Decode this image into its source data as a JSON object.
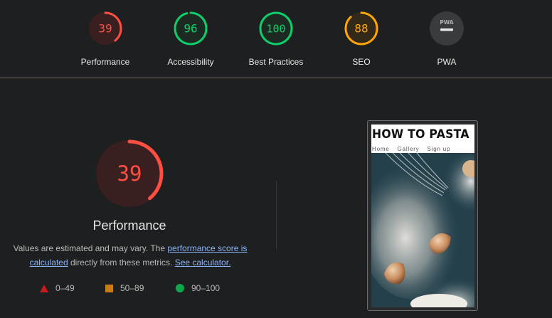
{
  "top_gauges": [
    {
      "name": "performance",
      "score": "39",
      "label": "Performance",
      "status": "fail",
      "fraction": 0.39
    },
    {
      "name": "accessibility",
      "score": "96",
      "label": "Accessibility",
      "status": "pass",
      "fraction": 0.96
    },
    {
      "name": "best-practices",
      "score": "100",
      "label": "Best Practices",
      "status": "pass",
      "fraction": 1.0
    },
    {
      "name": "seo",
      "score": "88",
      "label": "SEO",
      "status": "average",
      "fraction": 0.88
    },
    {
      "name": "pwa",
      "score": "",
      "label": "PWA",
      "status": "na",
      "fraction": 0,
      "badge": "PWA"
    }
  ],
  "colors": {
    "fail": "#ff4e42",
    "fail_bg": "#3a1f20",
    "average": "#ffa400",
    "average_bg": "#33291a",
    "pass": "#0cce6b",
    "pass_bg": "#1c2a22",
    "na_bg": "#3a3b3c",
    "link": "#8ab4f8"
  },
  "main": {
    "score": "39",
    "fraction": 0.39,
    "title": "Performance",
    "note_prefix": "Values are estimated and may vary. The ",
    "note_link1": "performance score is calculated",
    "note_middle": " directly from these metrics. ",
    "note_link2": "See calculator."
  },
  "legend": [
    {
      "icon": "triangle-icon",
      "label": "0–49"
    },
    {
      "icon": "square-icon",
      "label": "50–89"
    },
    {
      "icon": "circle-icon",
      "label": "90–100"
    }
  ],
  "thumbnail": {
    "site_title": "HOW TO PASTA",
    "nav": [
      "Home",
      "Gallery",
      "Sign up"
    ]
  }
}
